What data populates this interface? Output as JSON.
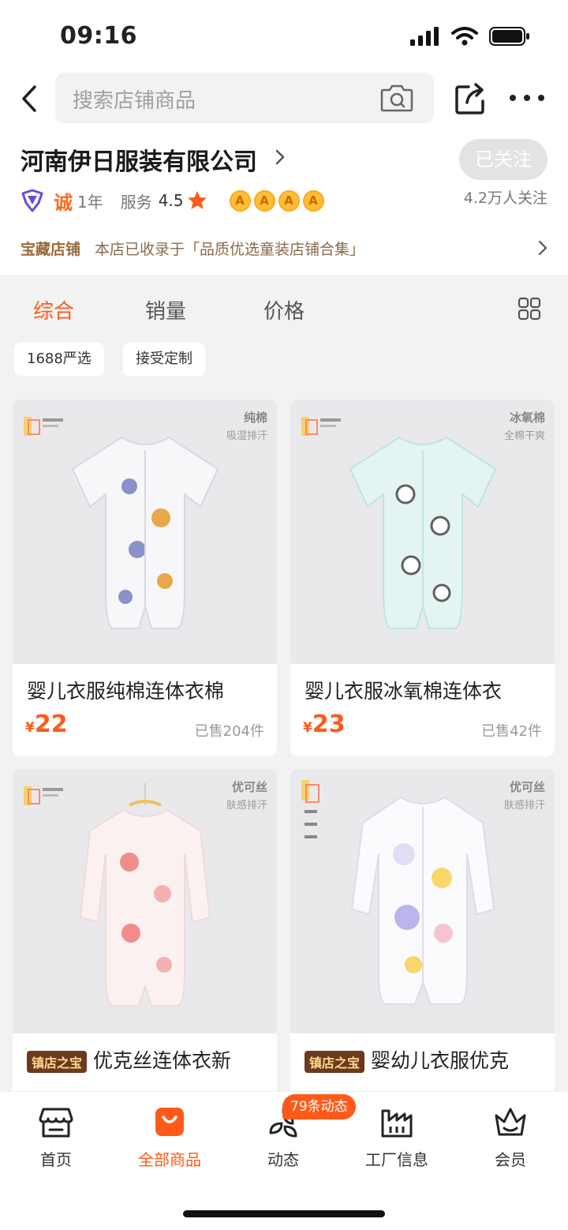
{
  "status_bar": {
    "time": "09:16"
  },
  "search": {
    "placeholder": "搜索店铺商品"
  },
  "shop": {
    "name": "河南伊日服装有限公司",
    "follow_label": "已关注",
    "followers": "4.2万人关注",
    "cheng_badge": "诚",
    "years": "1年",
    "service_label": "服务",
    "service_score": "4.5",
    "crowns": [
      "A",
      "A",
      "A",
      "A"
    ],
    "treasure_label": "宝藏店铺",
    "treasure_desc": "本店已收录于「品质优选童装店铺合集」"
  },
  "sort_tabs": [
    {
      "label": "综合",
      "active": true
    },
    {
      "label": "销量",
      "active": false
    },
    {
      "label": "价格",
      "active": false
    }
  ],
  "filters": [
    "1688严选",
    "接受定制"
  ],
  "products": [
    {
      "title": "婴儿衣服纯棉连体衣棉",
      "currency": "¥",
      "price": "22",
      "sold": "已售204件",
      "badge_title": "纯棉",
      "badge_sub": "吸湿排汗",
      "tag": "",
      "garment_color": "#f7f7fa",
      "accent": "#8a90c8"
    },
    {
      "title": "婴儿衣服冰氧棉连体衣",
      "currency": "¥",
      "price": "23",
      "sold": "已售42件",
      "badge_title": "冰氧棉",
      "badge_sub": "全棉干爽",
      "tag": "",
      "garment_color": "#e4f4f2",
      "accent": "#606060"
    },
    {
      "title": "优克丝连体衣新",
      "currency": "¥",
      "price": "",
      "sold": "",
      "badge_title": "优可丝",
      "badge_sub": "肤感排汗",
      "tag": "镇店之宝",
      "garment_color": "#fbf1f1",
      "accent": "#f08c8c"
    },
    {
      "title": "婴幼儿衣服优克",
      "currency": "¥",
      "price": "",
      "sold": "",
      "badge_title": "优可丝",
      "badge_sub": "肤感排汗",
      "tag": "镇店之宝",
      "garment_color": "#fbfbfd",
      "accent": "#b9b6ee"
    }
  ],
  "tabbar": {
    "items": [
      {
        "label": "首页",
        "icon": "storefront-icon",
        "active": false
      },
      {
        "label": "全部商品",
        "icon": "shopping-bag-icon",
        "active": true
      },
      {
        "label": "动态",
        "icon": "feed-icon",
        "active": false
      },
      {
        "label": "工厂信息",
        "icon": "factory-icon",
        "active": false
      },
      {
        "label": "会员",
        "icon": "crown-icon",
        "active": false
      }
    ],
    "feed_badge": "79条动态"
  },
  "colors": {
    "accent": "#ff5a1a",
    "treasure": "#9a6a3a",
    "tag_bg": "#6b3a1e"
  }
}
